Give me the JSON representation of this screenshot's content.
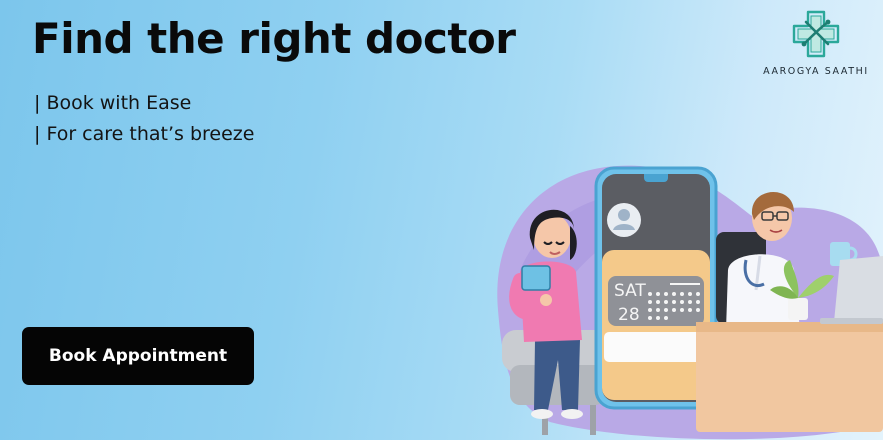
{
  "banner": {
    "headline": "Find the right doctor",
    "taglines": [
      "| Book with Ease",
      "| For care that’s breeze"
    ],
    "cta_label": "Book Appointment"
  },
  "brand": {
    "name": "AAROGYA SAATHI",
    "icon": "medical-cross-logo-icon",
    "color": "#2ba89a"
  },
  "calendar": {
    "day": "SAT",
    "date": "28"
  },
  "colors": {
    "background_start": "#7cc6ec",
    "background_end": "#e3f3fc",
    "cta_background": "#050505",
    "cta_text": "#ffffff",
    "blob": "#b9a9e6",
    "phone_card": "#f4c98a"
  }
}
